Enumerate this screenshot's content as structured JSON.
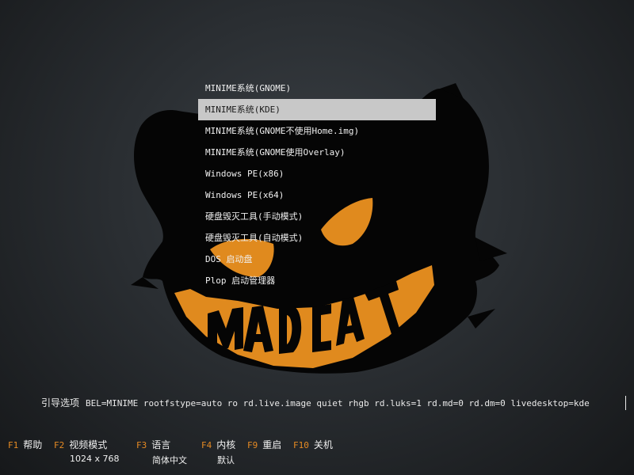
{
  "menu": {
    "items": [
      {
        "label": "MINIME系统(GNOME)"
      },
      {
        "label": "MINIME系统(KDE)",
        "selected": true
      },
      {
        "label": "MINIME系统(GNOME不使用Home.img)"
      },
      {
        "label": "MINIME系统(GNOME使用Overlay)"
      },
      {
        "label": "Windows PE(x86)"
      },
      {
        "label": "Windows PE(x64)"
      },
      {
        "label": "硬盘毁灭工具(手动模式)"
      },
      {
        "label": "硬盘毁灭工具(自动模式)"
      },
      {
        "label": "DOS 启动盘"
      },
      {
        "label": "Plop 启动管理器"
      }
    ]
  },
  "boot_options": {
    "label": "引导选项",
    "value": "BEL=MINIME rootfstype=auto ro rd.live.image quiet rhgb rd.luks=1 rd.md=0 rd.dm=0 livedesktop=kde"
  },
  "fkeys": [
    {
      "key": "F1",
      "label": "帮助",
      "sub": ""
    },
    {
      "key": "F2",
      "label": "视频模式",
      "sub": "1024 x 768"
    },
    {
      "key": "F3",
      "label": "语言",
      "sub": "简体中文"
    },
    {
      "key": "F4",
      "label": "内核",
      "sub": "默认"
    },
    {
      "key": "F9",
      "label": "重启",
      "sub": ""
    },
    {
      "key": "F10",
      "label": "关机",
      "sub": ""
    }
  ],
  "logo": {
    "text": "MADCAT"
  },
  "colors": {
    "accent": "#e58a23",
    "logo_orange": "#e08a1e",
    "selection": "#c8c8c8"
  }
}
